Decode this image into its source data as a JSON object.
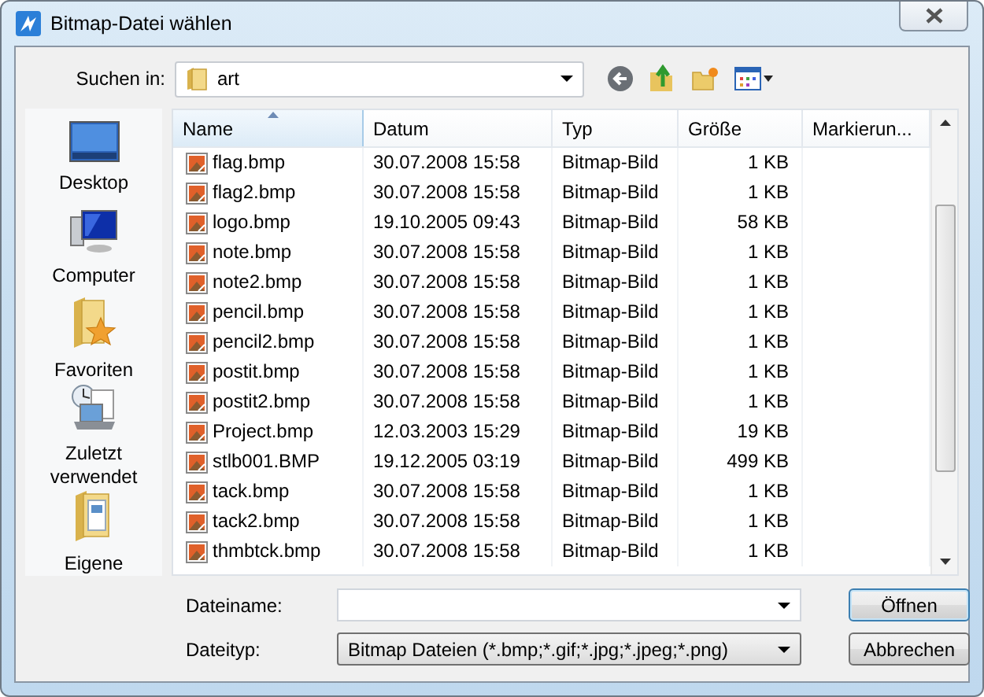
{
  "window": {
    "title": "Bitmap-Datei wählen"
  },
  "look_in": {
    "label": "Suchen in:",
    "value": "art"
  },
  "sidebar": {
    "items": [
      {
        "kind": "desktop",
        "label": "Desktop"
      },
      {
        "kind": "computer",
        "label": "Computer"
      },
      {
        "kind": "favorites",
        "label": "Favoriten"
      },
      {
        "kind": "recent",
        "label": "Zuletzt verwendet"
      },
      {
        "kind": "documents",
        "label": "Eigene"
      }
    ]
  },
  "table": {
    "columns": [
      {
        "label": "Name",
        "sorted": true
      },
      {
        "label": "Datum",
        "sorted": false
      },
      {
        "label": "Typ",
        "sorted": false
      },
      {
        "label": "Größe",
        "sorted": false
      },
      {
        "label": "Markierun...",
        "sorted": false
      }
    ],
    "rows": [
      {
        "name": "flag.bmp",
        "date": "30.07.2008 15:58",
        "type": "Bitmap-Bild",
        "size": "1 KB"
      },
      {
        "name": "flag2.bmp",
        "date": "30.07.2008 15:58",
        "type": "Bitmap-Bild",
        "size": "1 KB"
      },
      {
        "name": "logo.bmp",
        "date": "19.10.2005 09:43",
        "type": "Bitmap-Bild",
        "size": "58 KB"
      },
      {
        "name": "note.bmp",
        "date": "30.07.2008 15:58",
        "type": "Bitmap-Bild",
        "size": "1 KB"
      },
      {
        "name": "note2.bmp",
        "date": "30.07.2008 15:58",
        "type": "Bitmap-Bild",
        "size": "1 KB"
      },
      {
        "name": "pencil.bmp",
        "date": "30.07.2008 15:58",
        "type": "Bitmap-Bild",
        "size": "1 KB"
      },
      {
        "name": "pencil2.bmp",
        "date": "30.07.2008 15:58",
        "type": "Bitmap-Bild",
        "size": "1 KB"
      },
      {
        "name": "postit.bmp",
        "date": "30.07.2008 15:58",
        "type": "Bitmap-Bild",
        "size": "1 KB"
      },
      {
        "name": "postit2.bmp",
        "date": "30.07.2008 15:58",
        "type": "Bitmap-Bild",
        "size": "1 KB"
      },
      {
        "name": "Project.bmp",
        "date": "12.03.2003 15:29",
        "type": "Bitmap-Bild",
        "size": "19 KB"
      },
      {
        "name": "stlb001.BMP",
        "date": "19.12.2005 03:19",
        "type": "Bitmap-Bild",
        "size": "499 KB"
      },
      {
        "name": "tack.bmp",
        "date": "30.07.2008 15:58",
        "type": "Bitmap-Bild",
        "size": "1 KB"
      },
      {
        "name": "tack2.bmp",
        "date": "30.07.2008 15:58",
        "type": "Bitmap-Bild",
        "size": "1 KB"
      },
      {
        "name": "thmbtck.bmp",
        "date": "30.07.2008 15:58",
        "type": "Bitmap-Bild",
        "size": "1 KB"
      }
    ]
  },
  "file_name": {
    "label": "Dateiname:"
  },
  "file_type": {
    "label": "Dateityp:",
    "value": "Bitmap Dateien (*.bmp;*.gif;*.jpg;*.jpeg;*.png)"
  },
  "buttons": [
    {
      "label": "Öffnen",
      "default": true
    },
    {
      "label": "Abbrechen",
      "default": false
    }
  ]
}
